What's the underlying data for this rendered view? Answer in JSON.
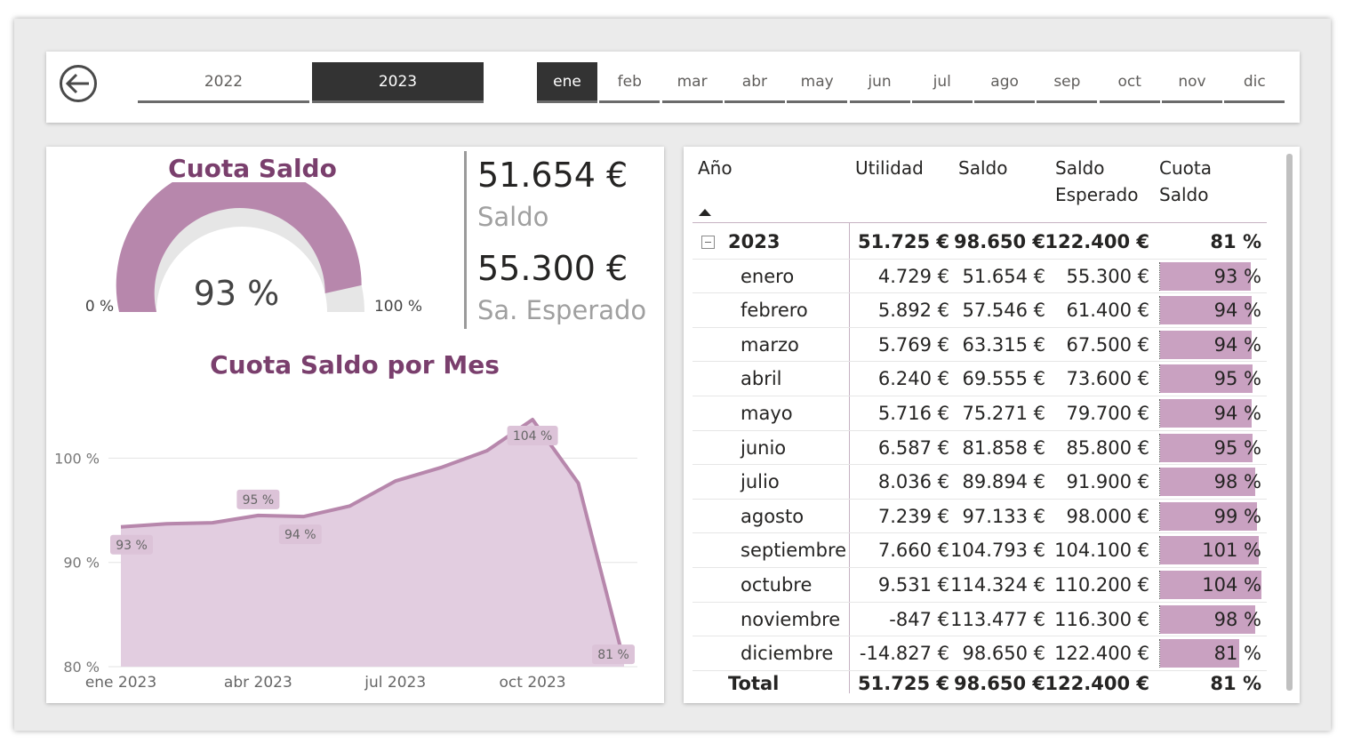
{
  "slicer": {
    "years": [
      {
        "label": "2022",
        "active": false
      },
      {
        "label": "2023",
        "active": true
      }
    ],
    "months": [
      {
        "label": "ene",
        "active": true
      },
      {
        "label": "feb",
        "active": false
      },
      {
        "label": "mar",
        "active": false
      },
      {
        "label": "abr",
        "active": false
      },
      {
        "label": "may",
        "active": false
      },
      {
        "label": "jun",
        "active": false
      },
      {
        "label": "jul",
        "active": false
      },
      {
        "label": "ago",
        "active": false
      },
      {
        "label": "sep",
        "active": false
      },
      {
        "label": "oct",
        "active": false
      },
      {
        "label": "nov",
        "active": false
      },
      {
        "label": "dic",
        "active": false
      }
    ],
    "back_icon": "back-arrow-icon"
  },
  "gauge": {
    "title": "Cuota Saldo",
    "value_label": "93 %",
    "value": 0.93,
    "min_label": "0 %",
    "max_label": "100 %",
    "fill_color": "#b787ac",
    "track_color": "#e6e6e6"
  },
  "kpis": {
    "saldo_value": "51.654 €",
    "saldo_label": "Saldo",
    "esperado_value": "55.300 €",
    "esperado_label": "Sa. Esperado"
  },
  "chart_data": {
    "type": "area",
    "title": "Cuota Saldo por Mes",
    "x": [
      "ene 2023",
      "feb 2023",
      "mar 2023",
      "abr 2023",
      "may 2023",
      "jun 2023",
      "jul 2023",
      "ago 2023",
      "sep 2023",
      "oct 2023",
      "nov 2023",
      "dic 2023"
    ],
    "x_tick_labels": [
      "ene 2023",
      "abr 2023",
      "jul 2023",
      "oct 2023"
    ],
    "series": [
      {
        "values": [
          93.4,
          93.7,
          93.8,
          94.5,
          94.4,
          95.4,
          97.8,
          99.1,
          100.7,
          103.7,
          97.6,
          80.5
        ]
      }
    ],
    "data_labels": [
      {
        "index": 0,
        "text": "93 %"
      },
      {
        "index": 3,
        "text": "95 %"
      },
      {
        "index": 4,
        "text": "94 %"
      },
      {
        "index": 9,
        "text": "104 %"
      },
      {
        "index": 11,
        "text": "81 %"
      }
    ],
    "y_ticks": [
      80,
      90,
      100
    ],
    "y_tick_labels": [
      "80 %",
      "90 %",
      "100 %"
    ],
    "ylim": [
      80,
      106
    ],
    "grid": true,
    "line_color": "#b787ac",
    "fill_color": "#e2cde0"
  },
  "table": {
    "headers": {
      "year": "Año",
      "utilidad": "Utilidad",
      "saldo": "Saldo",
      "esperado_1": "Saldo",
      "esperado_2": "Esperado",
      "cuota_1": "Cuota",
      "cuota_2": "Saldo"
    },
    "year_row": {
      "name": "2023",
      "util": "51.725 €",
      "saldo": "98.650 €",
      "esp": "122.400 €",
      "cuota": "81 %"
    },
    "rows": [
      {
        "name": "enero",
        "util": "4.729 €",
        "saldo": "51.654 €",
        "esp": "55.300 €",
        "cuota": "93 %",
        "pct": 93
      },
      {
        "name": "febrero",
        "util": "5.892 €",
        "saldo": "57.546 €",
        "esp": "61.400 €",
        "cuota": "94 %",
        "pct": 94
      },
      {
        "name": "marzo",
        "util": "5.769 €",
        "saldo": "63.315 €",
        "esp": "67.500 €",
        "cuota": "94 %",
        "pct": 94
      },
      {
        "name": "abril",
        "util": "6.240 €",
        "saldo": "69.555 €",
        "esp": "73.600 €",
        "cuota": "95 %",
        "pct": 95
      },
      {
        "name": "mayo",
        "util": "5.716 €",
        "saldo": "75.271 €",
        "esp": "79.700 €",
        "cuota": "94 %",
        "pct": 94
      },
      {
        "name": "junio",
        "util": "6.587 €",
        "saldo": "81.858 €",
        "esp": "85.800 €",
        "cuota": "95 %",
        "pct": 95
      },
      {
        "name": "julio",
        "util": "8.036 €",
        "saldo": "89.894 €",
        "esp": "91.900 €",
        "cuota": "98 %",
        "pct": 98
      },
      {
        "name": "agosto",
        "util": "7.239 €",
        "saldo": "97.133 €",
        "esp": "98.000 €",
        "cuota": "99 %",
        "pct": 99
      },
      {
        "name": "septiembre",
        "util": "7.660 €",
        "saldo": "104.793 €",
        "esp": "104.100 €",
        "cuota": "101 %",
        "pct": 101
      },
      {
        "name": "octubre",
        "util": "9.531 €",
        "saldo": "114.324 €",
        "esp": "110.200 €",
        "cuota": "104 %",
        "pct": 104
      },
      {
        "name": "noviembre",
        "util": "-847 €",
        "saldo": "113.477 €",
        "esp": "116.300 €",
        "cuota": "98 %",
        "pct": 98
      },
      {
        "name": "diciembre",
        "util": "-14.827 €",
        "saldo": "98.650 €",
        "esp": "122.400 €",
        "cuota": "81 %",
        "pct": 81
      }
    ],
    "total_row": {
      "name": "Total",
      "util": "51.725 €",
      "saldo": "98.650 €",
      "esp": "122.400 €",
      "cuota": "81 %"
    },
    "bar_color": "#c9a1c1"
  }
}
